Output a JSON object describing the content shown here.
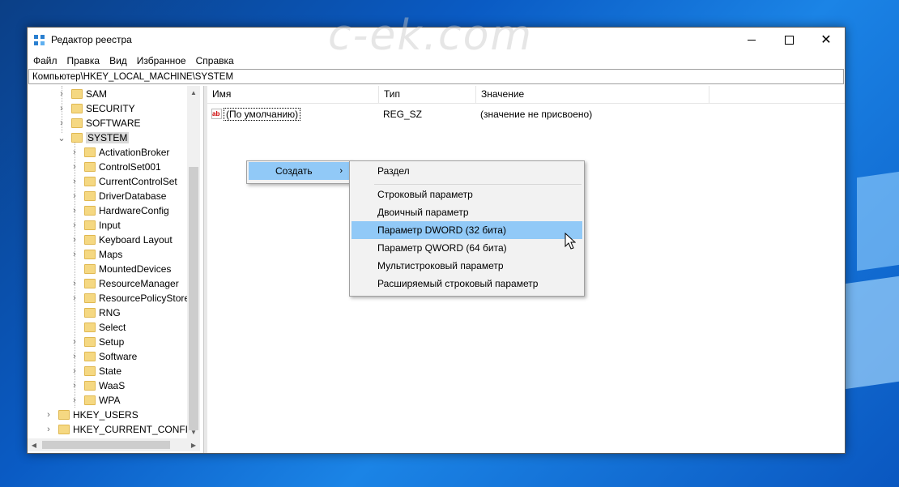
{
  "window": {
    "title": "Редактор реестра",
    "controls": {
      "minimize": "–",
      "maximize": "□",
      "close": "✕"
    }
  },
  "menu": [
    "Файл",
    "Правка",
    "Вид",
    "Избранное",
    "Справка"
  ],
  "address": "Компьютер\\HKEY_LOCAL_MACHINE\\SYSTEM",
  "tree": {
    "top_items": [
      {
        "label": "SAM",
        "expandable": true
      },
      {
        "label": "SECURITY",
        "expandable": true
      },
      {
        "label": "SOFTWARE",
        "expandable": true
      },
      {
        "label": "SYSTEM",
        "expandable": true,
        "expanded": true,
        "selected": true
      }
    ],
    "system_children": [
      {
        "label": "ActivationBroker",
        "expandable": true
      },
      {
        "label": "ControlSet001",
        "expandable": true
      },
      {
        "label": "CurrentControlSet",
        "expandable": true
      },
      {
        "label": "DriverDatabase",
        "expandable": true
      },
      {
        "label": "HardwareConfig",
        "expandable": true
      },
      {
        "label": "Input",
        "expandable": true
      },
      {
        "label": "Keyboard Layout",
        "expandable": true
      },
      {
        "label": "Maps",
        "expandable": true
      },
      {
        "label": "MountedDevices",
        "expandable": false
      },
      {
        "label": "ResourceManager",
        "expandable": true
      },
      {
        "label": "ResourcePolicyStore",
        "expandable": true
      },
      {
        "label": "RNG",
        "expandable": false
      },
      {
        "label": "Select",
        "expandable": false
      },
      {
        "label": "Setup",
        "expandable": true
      },
      {
        "label": "Software",
        "expandable": true
      },
      {
        "label": "State",
        "expandable": true
      },
      {
        "label": "WaaS",
        "expandable": true
      },
      {
        "label": "WPA",
        "expandable": true
      }
    ],
    "root_items": [
      {
        "label": "HKEY_USERS",
        "expandable": true
      },
      {
        "label": "HKEY_CURRENT_CONFIG",
        "expandable": true
      }
    ]
  },
  "list": {
    "columns": [
      "Имя",
      "Тип",
      "Значение"
    ],
    "rows": [
      {
        "name": "(По умолчанию)",
        "type": "REG_SZ",
        "value": "(значение не присвоено)"
      }
    ]
  },
  "context_menu": {
    "create_label": "Создать",
    "submenu": [
      {
        "label": "Раздел",
        "highlighted": false
      },
      {
        "label": "Строковый параметр",
        "highlighted": false
      },
      {
        "label": "Двоичный параметр",
        "highlighted": false
      },
      {
        "label": "Параметр DWORD (32 бита)",
        "highlighted": true
      },
      {
        "label": "Параметр QWORD (64 бита)",
        "highlighted": false
      },
      {
        "label": "Мультистроковый параметр",
        "highlighted": false
      },
      {
        "label": "Расширяемый строковый параметр",
        "highlighted": false
      }
    ]
  },
  "watermark": "c-ek.com",
  "colors": {
    "highlight": "#91c9f7",
    "folder": "#f5d882",
    "desktop": "#0a5bc4"
  }
}
